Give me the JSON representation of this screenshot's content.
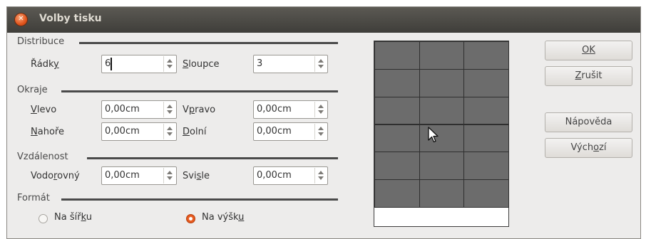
{
  "window": {
    "title": "Volby tisku",
    "close_icon": "close-icon"
  },
  "sections": {
    "distribution": "Distribuce",
    "margins": "Okraje",
    "distance": "Vzdálenost",
    "format": "Formát"
  },
  "distribution": {
    "rows": {
      "label_pre": "Řádk",
      "label_key": "y",
      "value": "6"
    },
    "cols": {
      "label_key": "S",
      "label_post": "loupce",
      "value": "3"
    }
  },
  "margins": {
    "left": {
      "label_key": "V",
      "label_post": "levo",
      "value": "0,00cm"
    },
    "right": {
      "label_pre": "V",
      "label_key": "p",
      "label_post": "ravo",
      "value": "0,00cm"
    },
    "top": {
      "label_key": "N",
      "label_post": "ahoře",
      "value": "0,00cm"
    },
    "bottom": {
      "label_key": "D",
      "label_post": "olní",
      "value": "0,00cm"
    }
  },
  "distance": {
    "horizontal": {
      "label_pre": "Vodo",
      "label_key": "r",
      "label_post": "ovný",
      "value": "0,00cm"
    },
    "vertical": {
      "label_pre": "Svi",
      "label_key": "s",
      "label_post": "le",
      "value": "0,00cm"
    }
  },
  "format": {
    "landscape": {
      "label_pre": "Na šíř",
      "label_key": "k",
      "label_post": "u",
      "checked": false
    },
    "portrait": {
      "label_pre": "Na výšk",
      "label_key": "u",
      "label_post": "",
      "checked": true
    }
  },
  "preview": {
    "rows": 6,
    "cols": 3
  },
  "buttons": {
    "ok": {
      "label_key": "O",
      "label_post": "K"
    },
    "cancel": {
      "label_key": "Z",
      "label_post": "rušit"
    },
    "help": {
      "label": "Nápověda"
    },
    "default": {
      "label_pre": "Vých",
      "label_key": "o",
      "label_post": "zí"
    }
  },
  "colors": {
    "titlebar": "#4d4b46",
    "accent": "#e0541c",
    "cell": "#6c6c6c"
  }
}
